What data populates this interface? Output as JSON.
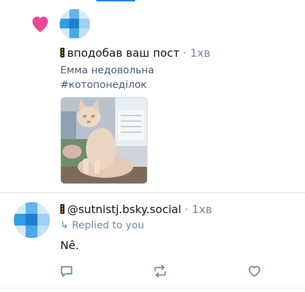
{
  "like_notification": {
    "icon": "heart-icon",
    "heart_color": "#ec4899",
    "actor_name": "",
    "action_text": "вподобав ваш пост",
    "separator": "·",
    "time": "1хв",
    "post_line1": "Емма недовольна",
    "post_line2": "#котопонеділок",
    "image": "cat-photo"
  },
  "reply_post": {
    "handle": "@sutnistj.bsky.social",
    "separator": "·",
    "time": "1хв",
    "replied_label": "↳ Replied to you",
    "text": "Nê.",
    "actions": [
      "reply-icon",
      "repost-icon",
      "like-icon"
    ]
  },
  "colors": {
    "accent": "#1083fe",
    "muted": "#6f869f",
    "divider": "#e2e7ee"
  }
}
